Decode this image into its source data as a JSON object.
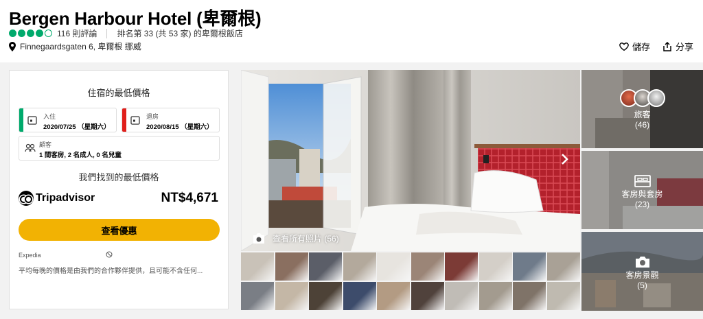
{
  "hotel": {
    "name": "Bergen Harbour Hotel (卑爾根)",
    "rating_bubbles": 4,
    "rating_max": 5,
    "reviews": "116 則評論",
    "ranking": "排名第 33 (共 53 家) 的卑爾根飯店",
    "address": "Finnegaardsgaten 6, 卑爾根 挪威"
  },
  "actions": {
    "save": "儲存",
    "share": "分享"
  },
  "booking": {
    "title": "住宿的最低價格",
    "checkin_label": "入住",
    "checkin_value": "2020/07/25 （星期六）",
    "checkout_label": "退房",
    "checkout_value": "2020/08/15 （星期六）",
    "guests_label": "顧客",
    "guests_value": "1 間客房, 2 名成人, 0 名兒童",
    "found_text": "我們找到的最低價格",
    "provider": "Tripadvisor",
    "price": "NT$4,671",
    "deal_button": "查看優惠",
    "partner": "Expedia",
    "note": "平均每晚的價格是由我們的合作夥伴提供，且可能不含任何..."
  },
  "gallery": {
    "see_all": "查看所有照片 (56)",
    "tiles": [
      {
        "label": "旅客",
        "count": "(46)"
      },
      {
        "label": "客房與套房",
        "count": "(23)"
      },
      {
        "label": "客房景觀",
        "count": "(5)"
      }
    ],
    "thumb_colors": [
      "#c9c2b8",
      "#8a6f60",
      "#5b5e68",
      "#b3a99c",
      "#e7e4df",
      "#9b8577",
      "#7c3b36",
      "#d4cfc8",
      "#6f7b8a",
      "#a9a196",
      "#7a7e85",
      "#c4b7a6",
      "#4d4237",
      "#3d4c6b",
      "#b39b83",
      "#50423c",
      "#c0bcb6",
      "#a39b8f",
      "#7f7368",
      "#bfbab0"
    ]
  },
  "colors": {
    "rating_green": "#00aa6c",
    "checkin_stripe": "#00aa6c",
    "checkout_stripe": "#e0201c",
    "deal_button": "#f2b203"
  },
  "icons": {
    "location": "map-pin-icon",
    "save": "heart-icon",
    "share": "share-icon",
    "calendar": "calendar-icon",
    "guests": "people-icon",
    "camera": "camera-icon",
    "next": "chevron-right-icon",
    "bed": "bed-icon",
    "no_entry": "no-entry-icon"
  }
}
